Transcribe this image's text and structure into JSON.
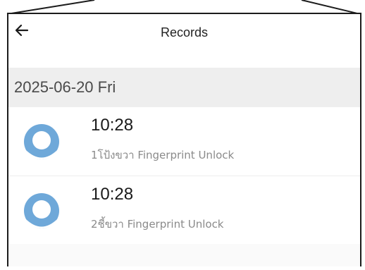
{
  "header": {
    "title": "Records",
    "back_icon": "arrow-left-icon"
  },
  "date_group": {
    "label": "2025-06-20 Fri"
  },
  "records": [
    {
      "time": "10:28",
      "description": "1โป้งขวา Fingerprint Unlock",
      "avatar_icon": "user-avatar-icon"
    },
    {
      "time": "10:28",
      "description": "2ชี้ขวา Fingerprint Unlock",
      "avatar_icon": "user-avatar-icon"
    }
  ],
  "colors": {
    "avatar": "#6ea8d9",
    "header_bg": "#ffffff",
    "date_bg": "#eeeeee",
    "secondary_text": "#8a8a8a"
  }
}
